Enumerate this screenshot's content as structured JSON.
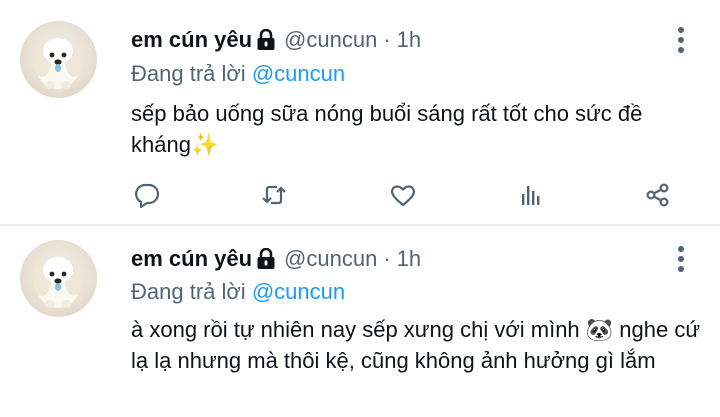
{
  "tweets": [
    {
      "name": "em cún yêu",
      "handle": "@cuncun",
      "separator": "·",
      "time": "1h",
      "reply_prefix": "Đang trả lời",
      "reply_mention": "@cuncun",
      "text": "sếp bảo uống sữa nóng buổi sáng rất tốt cho sức đề kháng✨"
    },
    {
      "name": "em cún yêu",
      "handle": "@cuncun",
      "separator": "·",
      "time": "1h",
      "reply_prefix": "Đang trả lời",
      "reply_mention": "@cuncun",
      "text": "à xong rồi tự nhiên nay sếp xưng chị với mình 🐼 nghe cứ lạ lạ nhưng mà thôi kệ, cũng không ảnh hưởng gì lắm"
    }
  ],
  "icons": {
    "lock": "lock-icon",
    "more": "more-vertical-icon",
    "reply": "reply-icon",
    "retweet": "retweet-icon",
    "like": "like-icon",
    "analytics": "analytics-icon",
    "share": "share-icon"
  },
  "colors": {
    "accent": "#1d9bf0",
    "secondary_text": "#536471",
    "primary_text": "#0f1419",
    "divider": "#e6ecf0"
  }
}
